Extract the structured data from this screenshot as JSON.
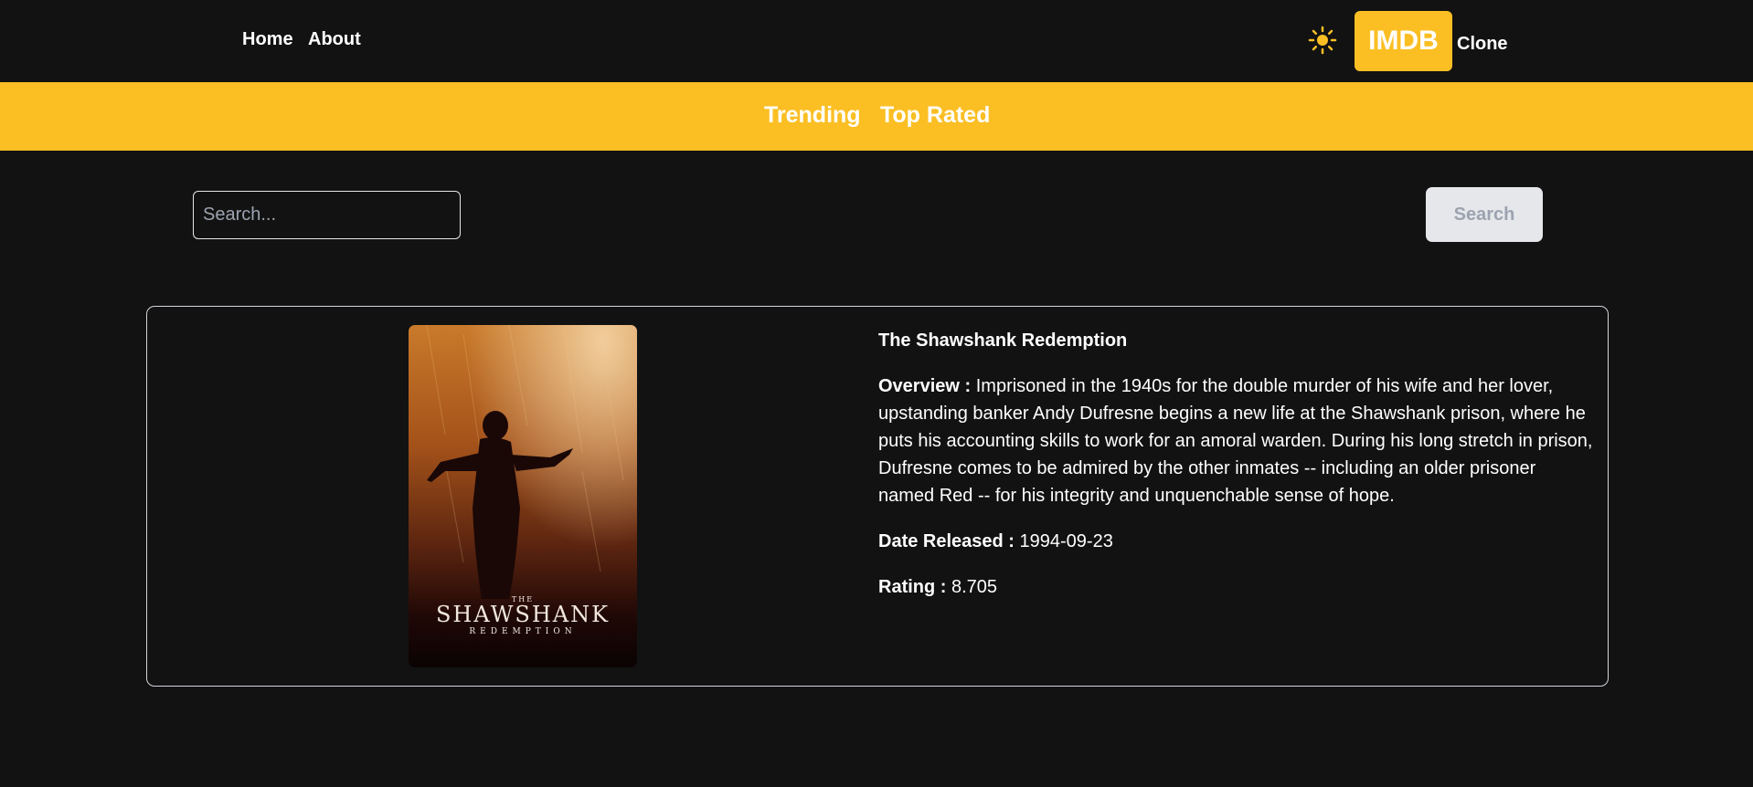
{
  "nav": {
    "home": "Home",
    "about": "About",
    "theme_icon": "sun-icon",
    "logo_text": "IMDB",
    "logo_suffix": "Clone"
  },
  "tabs": [
    {
      "label": "Trending"
    },
    {
      "label": "Top Rated"
    }
  ],
  "search": {
    "placeholder": "Search...",
    "value": "",
    "button_label": "Search"
  },
  "movie": {
    "title": "The Shawshank Redemption",
    "overview_label": "Overview :",
    "overview": "Imprisoned in the 1940s for the double murder of his wife and her lover, upstanding banker Andy Dufresne begins a new life at the Shawshank prison, where he puts his accounting skills to work for an amoral warden. During his long stretch in prison, Dufresne comes to be admired by the other inmates -- including an older prisoner named Red -- for his integrity and unquenchable sense of hope.",
    "date_label": "Date Released :",
    "date": "1994-09-23",
    "rating_label": "Rating :",
    "rating": "8.705",
    "poster": {
      "line_the": "THE",
      "line_title": "SHAWSHANK",
      "line_sub": "REDEMPTION"
    }
  },
  "colors": {
    "accent": "#fbbf24",
    "background": "#121212",
    "button_bg": "#e5e7eb"
  }
}
